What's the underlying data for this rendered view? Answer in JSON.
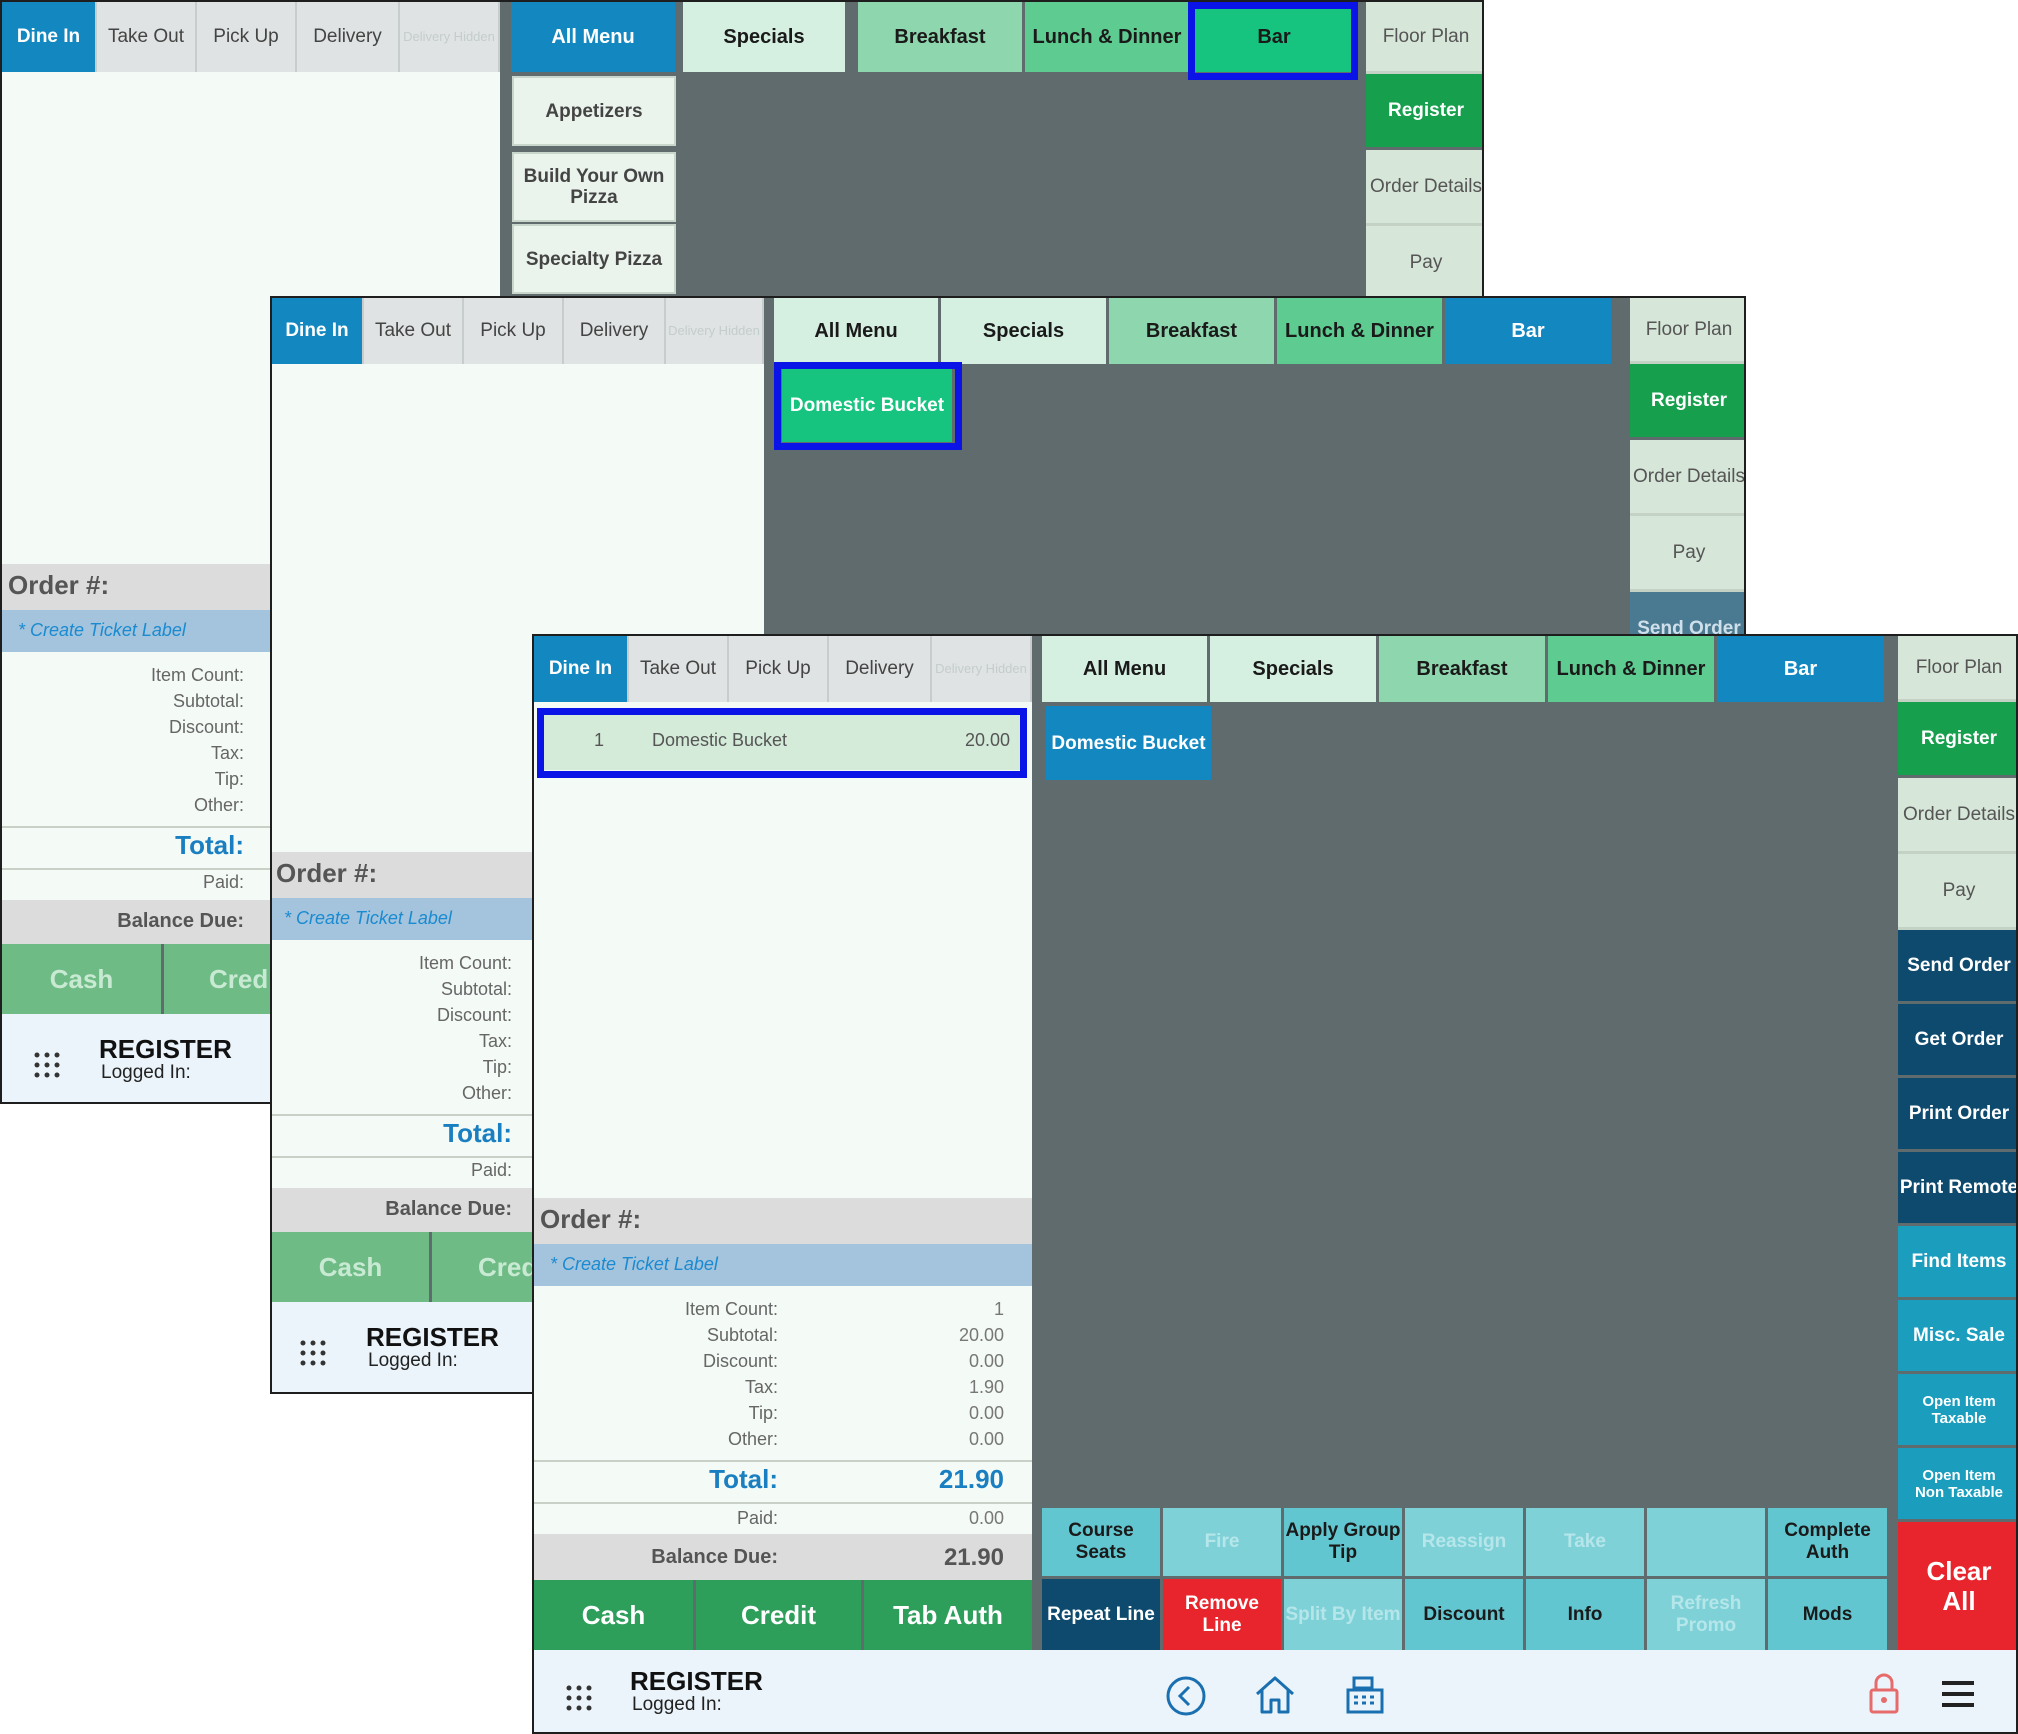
{
  "order_tabs": {
    "dine_in": "Dine In",
    "take_out": "Take Out",
    "pick_up": "Pick Up",
    "delivery": "Delivery",
    "delivery_hidden": "Delivery Hidden"
  },
  "menu_tabs": {
    "all_menu": "All Menu",
    "specials": "Specials",
    "breakfast": "Breakfast",
    "lunch_dinner": "Lunch & Dinner",
    "bar": "Bar"
  },
  "side_buttons": {
    "floor_plan": "Floor Plan",
    "register": "Register",
    "order_details": "Order Details",
    "pay": "Pay",
    "send_order": "Send Order",
    "get_order": "Get Order",
    "print_order": "Print Order",
    "print_remote": "Print Remote",
    "find_items": "Find Items",
    "misc_sale": "Misc. Sale",
    "open_taxable": "Open Item Taxable",
    "open_non_taxable": "Open Item Non Taxable",
    "clear_all": "Clear All"
  },
  "categories": {
    "appetizers": "Appetizers",
    "build_pizza": "Build Your Own Pizza",
    "specialty_pizza": "Specialty Pizza"
  },
  "bar_item": "Domestic Bucket",
  "order_line": {
    "qty": "1",
    "name": "Domestic Bucket",
    "price": "20.00"
  },
  "order": {
    "order_no": "Order #:",
    "ticket_label": "* Create Ticket Label",
    "labels": {
      "item_count": "Item Count:",
      "subtotal": "Subtotal:",
      "discount": "Discount:",
      "tax": "Tax:",
      "tip": "Tip:",
      "other": "Other:"
    },
    "values": {
      "item_count": "1",
      "subtotal": "20.00",
      "discount": "0.00",
      "tax": "1.90",
      "tip": "0.00",
      "other": "0.00"
    },
    "total_label": "Total:",
    "total": "21.90",
    "paid_label": "Paid:",
    "paid": "0.00",
    "balance_label": "Balance Due:",
    "balance": "21.90"
  },
  "pay_buttons": {
    "cash": "Cash",
    "credit": "Credit",
    "credit_cut": "Cred",
    "credit_cut2": "Cred",
    "tab_auth": "Tab Auth"
  },
  "bottom_actions": {
    "course_seats": "Course Seats",
    "fire": "Fire",
    "apply_group_tip": "Apply Group Tip",
    "reassign": "Reassign",
    "take": "Take",
    "complete_auth": "Complete Auth",
    "repeat_line": "Repeat Line",
    "remove_line": "Remove Line",
    "split_by_item": "Split By Item",
    "discount": "Discount",
    "info": "Info",
    "refresh_promo": "Refresh Promo",
    "mods": "Mods"
  },
  "footer": {
    "app": "REGISTER",
    "logged_in": "Logged In:"
  },
  "colors": {
    "highlight": "#0a14e6",
    "active_tab": "#1387c0",
    "register": "#16a04e",
    "dark_btn": "#0d4a6e",
    "teal_btn": "#1b9dbd",
    "clear": "#e8242c"
  }
}
